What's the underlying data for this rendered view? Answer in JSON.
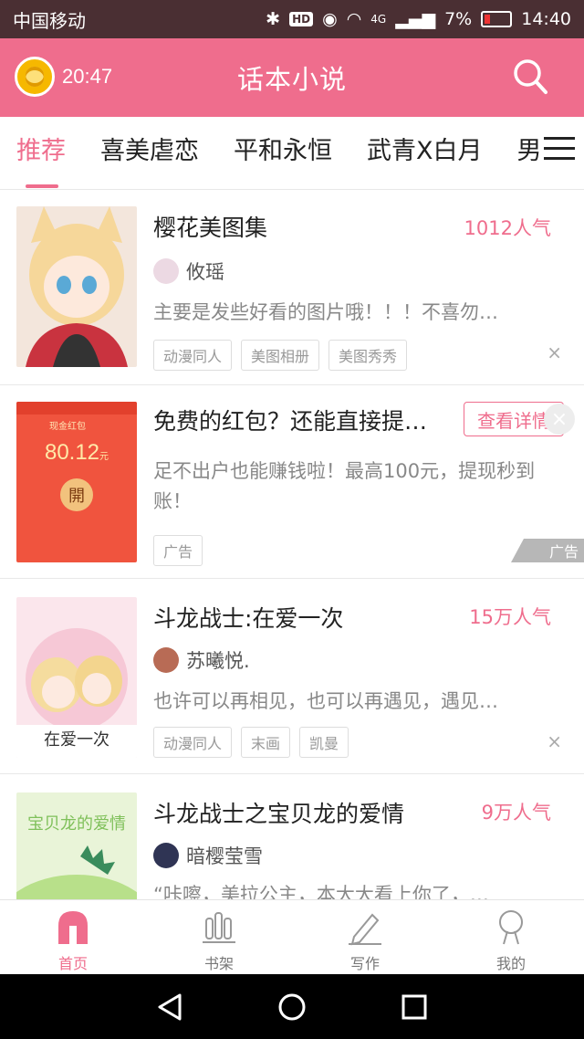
{
  "status": {
    "carrier": "中国移动",
    "hd": "HD",
    "signal_type": "4G",
    "battery": "7%",
    "time": "14:40"
  },
  "appbar": {
    "timer": "20:47",
    "title": "话本小说"
  },
  "tabs": [
    "推荐",
    "喜美虐恋",
    "平和永恒",
    "武青X白月",
    "男"
  ],
  "cards": [
    {
      "title": "樱花美图集",
      "popularity": "1012人气",
      "author": "攸瑶",
      "desc": "主要是发些好看的图片哦！！！不喜勿…",
      "tags": [
        "动漫同人",
        "美图相册",
        "美图秀秀"
      ],
      "close": "×"
    },
    {
      "title": "斗龙战士:在爱一次",
      "popularity": "15万人气",
      "author": "苏曦悦.",
      "desc": "也许可以再相见，也可以再遇见，遇见…",
      "tags": [
        "动漫同人",
        "末画",
        "凯曼"
      ],
      "close": "×"
    },
    {
      "title": "斗龙战士之宝贝龙的爱情",
      "popularity": "9万人气",
      "author": "暗樱莹雪",
      "desc": "“咔嚓，美拉公主，本大大看上你了，…"
    }
  ],
  "ad": {
    "title": "免费的红包？还能直接提…",
    "button": "查看详情",
    "desc": "足不出户也能赚钱啦！最高100元，提现秒到账！",
    "tag": "广告",
    "label": "广告",
    "close": "×",
    "envelope_title": "现金红包",
    "amount": "80.12",
    "currency": "元",
    "open": "開"
  },
  "bottom_nav": [
    {
      "label": "首页",
      "icon": "home-icon"
    },
    {
      "label": "书架",
      "icon": "bookshelf-icon"
    },
    {
      "label": "写作",
      "icon": "pen-icon"
    },
    {
      "label": "我的",
      "icon": "profile-icon"
    }
  ],
  "colors": {
    "accent": "#ef6d8d",
    "statusbar": "#4a2f33",
    "ad_red": "#f0543e"
  }
}
